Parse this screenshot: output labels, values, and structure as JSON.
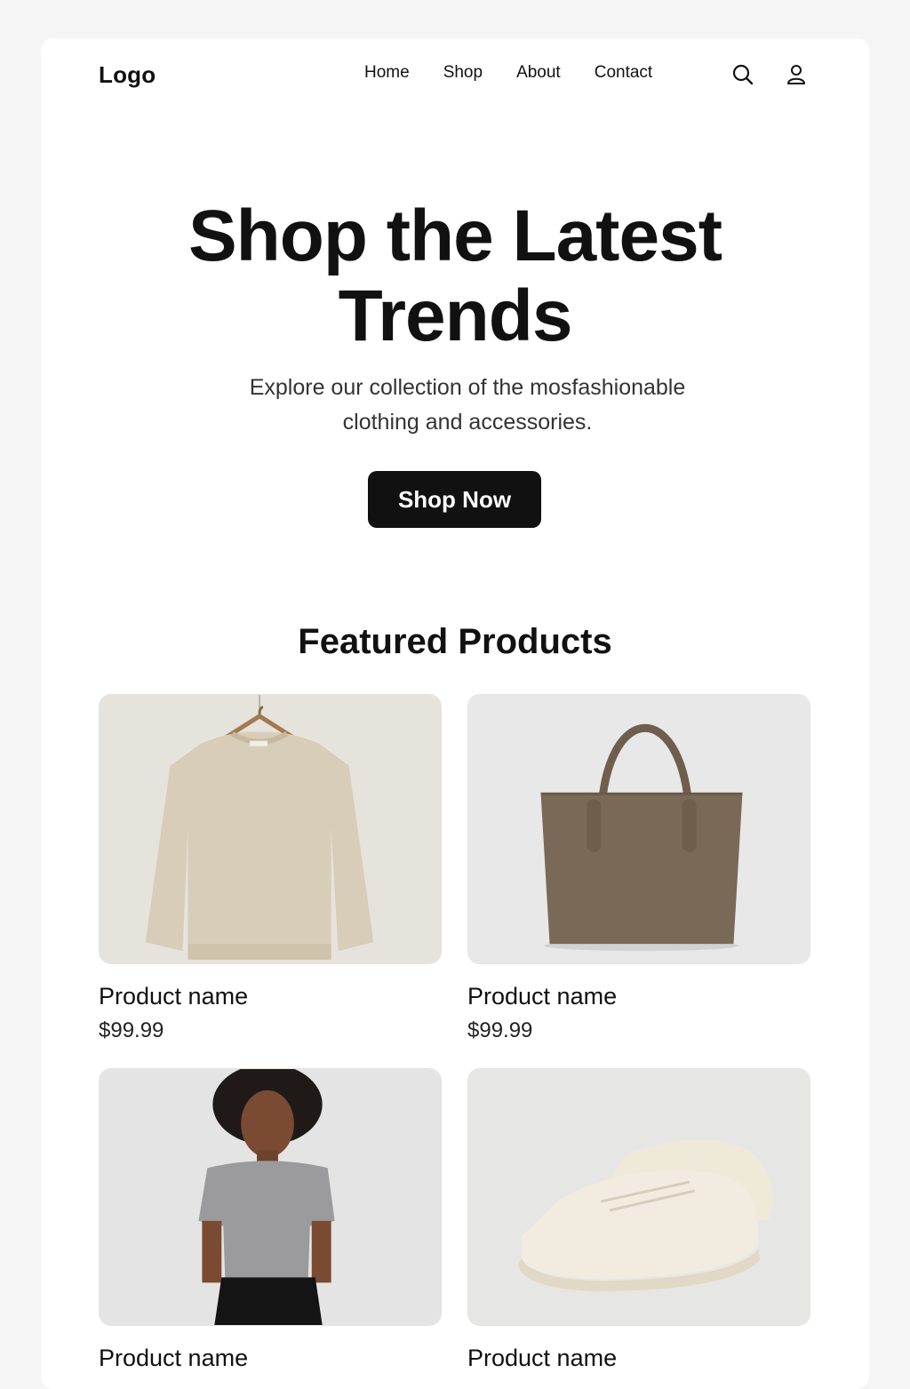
{
  "header": {
    "logo": "Logo",
    "nav": [
      "Home",
      "Shop",
      "About",
      "Contact"
    ],
    "icons": [
      "search-icon",
      "user-icon"
    ]
  },
  "hero": {
    "title_line1": "Shop the Latest",
    "title_line2": "Trends",
    "subtitle": "Explore our collection of the mosfashionable clothing and accessories.",
    "cta_label": "Shop Now"
  },
  "featured": {
    "title": "Featured Products",
    "products": [
      {
        "name": "Product name",
        "price": "$99.99",
        "image": "beige-sweater-on-hanger"
      },
      {
        "name": "Product name",
        "price": "$99.99",
        "image": "taupe-tote-bag"
      },
      {
        "name": "Product name",
        "price": "",
        "image": "woman-in-grey-tshirt"
      },
      {
        "name": "Product name",
        "price": "",
        "image": "cream-sneakers"
      }
    ]
  },
  "colors": {
    "background": "#f5f5f5",
    "card": "#ffffff",
    "text": "#111111",
    "cta": "#111111"
  }
}
